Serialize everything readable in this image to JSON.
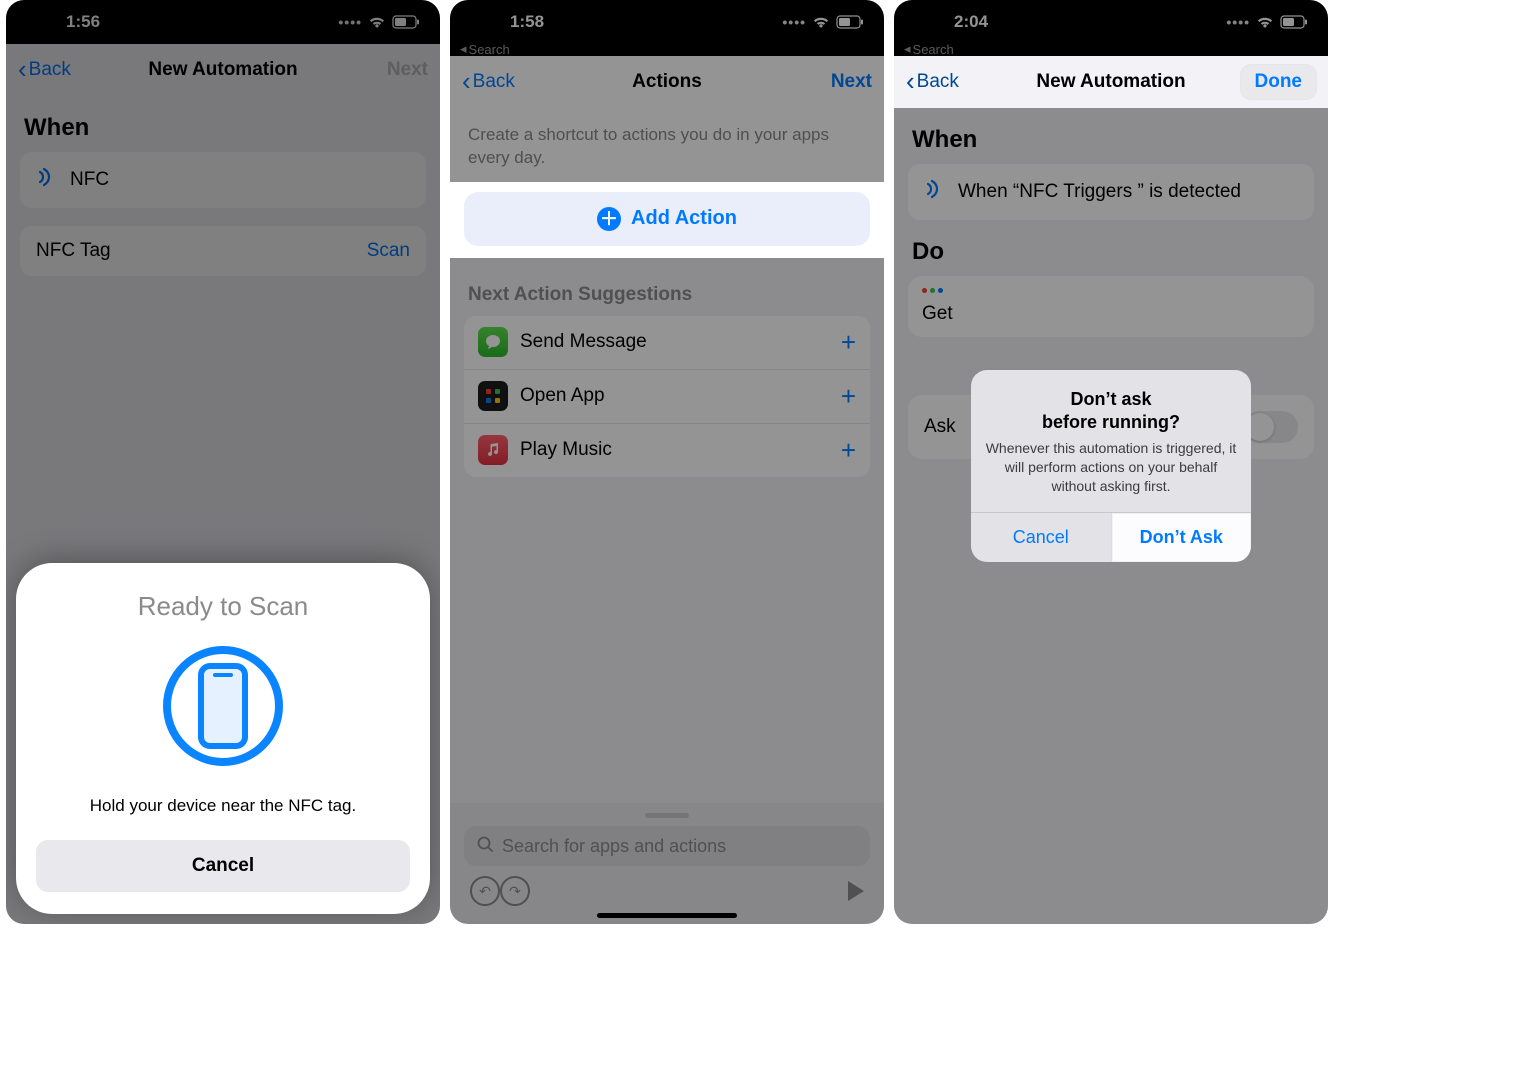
{
  "screen1": {
    "status": {
      "time": "1:56"
    },
    "nav": {
      "back": "Back",
      "title": "New Automation",
      "next": "Next"
    },
    "when_header": "When",
    "nfc_label": "NFC",
    "nfc_tag_label": "NFC Tag",
    "scan_link": "Scan",
    "sheet": {
      "title": "Ready to Scan",
      "message": "Hold your device near the NFC tag.",
      "cancel": "Cancel"
    }
  },
  "screen2": {
    "status": {
      "time": "1:58"
    },
    "breadcrumb": "Search",
    "nav": {
      "back": "Back",
      "title": "Actions",
      "next": "Next"
    },
    "description": "Create a shortcut to actions you do in your apps every day.",
    "add_action": "Add Action",
    "suggestions_header": "Next Action Suggestions",
    "suggestions": [
      {
        "label": "Send Message"
      },
      {
        "label": "Open App"
      },
      {
        "label": "Play Music"
      }
    ],
    "search_placeholder": "Search for apps and actions"
  },
  "screen3": {
    "status": {
      "time": "2:04"
    },
    "breadcrumb": "Search",
    "nav": {
      "back": "Back",
      "title": "New Automation",
      "done": "Done"
    },
    "when_header": "When",
    "when_text": "When “NFC Triggers ” is detected",
    "do_header": "Do",
    "do_label": "Get",
    "ask_label": "Ask",
    "alert": {
      "title": "Don’t ask\nbefore running?",
      "message": "Whenever this automation is triggered, it will perform actions on your behalf without asking first.",
      "cancel": "Cancel",
      "confirm": "Don’t Ask"
    }
  }
}
